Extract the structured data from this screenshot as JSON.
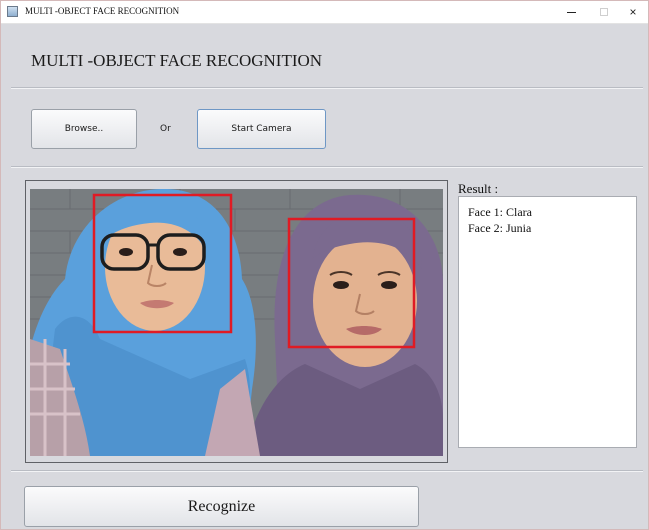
{
  "window": {
    "title": "MULTI -OBJECT FACE RECOGNITION",
    "controls": {
      "minimize": "–",
      "close": "×"
    }
  },
  "header": {
    "heading": "MULTI -OBJECT FACE RECOGNITION"
  },
  "toolbar": {
    "browse_label": "Browse..",
    "or_label": "Or",
    "camera_label": "Start Camera"
  },
  "result": {
    "label": "Result :",
    "lines": [
      "Face 1: Clara",
      "Face 2: Junia"
    ]
  },
  "recognize_label": "Recognize",
  "colors": {
    "detection_box": "#e01b24",
    "window_bg": "#d8d9de"
  }
}
